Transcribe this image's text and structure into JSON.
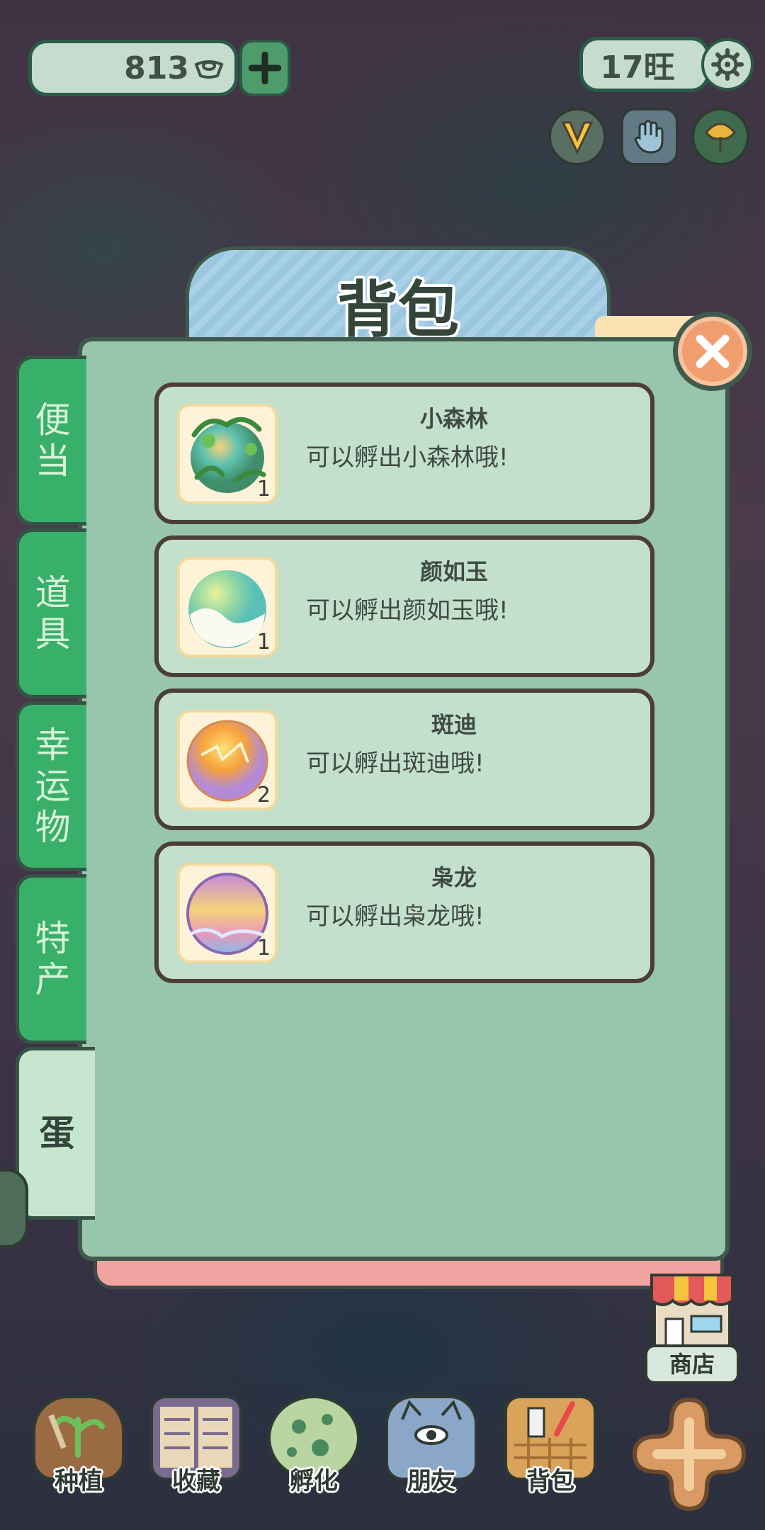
{
  "top_bar": {
    "coins": "813",
    "coin_icon": "ingot-icon",
    "wang": "17旺"
  },
  "panel": {
    "title": "背包"
  },
  "side_tabs": [
    {
      "label": "便当",
      "active": false
    },
    {
      "label": "道具",
      "active": false
    },
    {
      "label": "幸运物",
      "active": false
    },
    {
      "label": "特产",
      "active": false
    },
    {
      "label": "蛋",
      "active": true
    }
  ],
  "items": [
    {
      "name": "小森林",
      "desc": "可以孵出小森林哦!",
      "count": "1",
      "color": "#6fb882"
    },
    {
      "name": "颜如玉",
      "desc": "可以孵出颜如玉哦!",
      "count": "1",
      "color": "#e8d25a"
    },
    {
      "name": "斑迪",
      "desc": "可以孵出斑迪哦!",
      "count": "2",
      "color": "#f2a13a"
    },
    {
      "name": "枭龙",
      "desc": "可以孵出枭龙哦!",
      "count": "1",
      "color": "#b58ad0"
    }
  ],
  "shop": {
    "label": "商店"
  },
  "bottom_nav": [
    {
      "label": "种植"
    },
    {
      "label": "收藏"
    },
    {
      "label": "孵化"
    },
    {
      "label": "朋友"
    },
    {
      "label": "背包"
    }
  ],
  "colors": {
    "panel": "#97c6ac",
    "tab_green": "#39b06a",
    "card": "#c3e0cc",
    "close": "#f09e6e"
  }
}
